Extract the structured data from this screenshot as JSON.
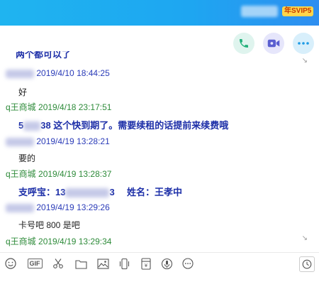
{
  "header": {
    "vip_label": "年SVIP5"
  },
  "actions": {
    "call_icon": "phone-icon",
    "video_icon": "video-camera-icon",
    "more_icon": "more-dots-icon"
  },
  "messages": {
    "cutoff_text": "两个都可以了",
    "m1_time": "2019/4/10 18:44:25",
    "m1_text": "好",
    "m2_sender": "q王商城",
    "m2_time": "2019/4/18 23:17:51",
    "m2_prefix": "5",
    "m2_suffix": "38 这个快到期了。需要续租的话提前来续费哦",
    "m3_time": "2019/4/19 13:28:21",
    "m3_text": "要的",
    "m4_sender": "q王商城",
    "m4_time": "2019/4/19 13:28:37",
    "m4_label": "支呼宝：13",
    "m4_tail": "3",
    "m4_name": "姓名：王孝中",
    "m5_time": "2019/4/19 13:29:26",
    "m5_text": "卡号吧  800  是吧",
    "m6_sender": "q王商城",
    "m6_time": "2019/4/19 13:29:34"
  },
  "toolbar": {
    "gif_label": "GIF",
    "icons": [
      "emoji-icon",
      "gif-icon",
      "scissors-icon",
      "folder-icon",
      "image-icon",
      "shake-icon",
      "red-packet-icon",
      "voice-icon",
      "more-icon",
      "history-icon"
    ]
  }
}
